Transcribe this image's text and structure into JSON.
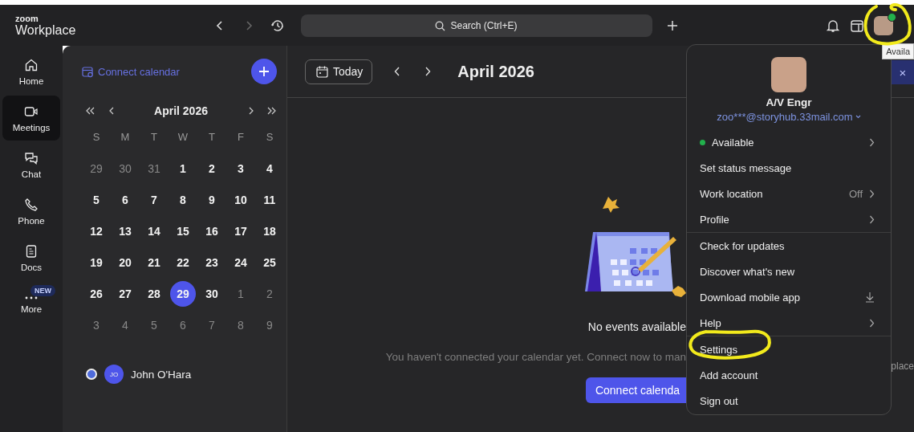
{
  "titlebar": {
    "logo_small": "zoom",
    "logo_name": "Workplace",
    "back_disabled": false,
    "forward_disabled": true,
    "search": {
      "placeholder": "Search (Ctrl+E)"
    },
    "online": true,
    "tooltip": "Availa"
  },
  "rail": [
    {
      "label": "Home",
      "selected": false
    },
    {
      "label": "Meetings",
      "selected": true
    },
    {
      "label": "Chat",
      "selected": false
    },
    {
      "label": "Phone",
      "selected": false
    },
    {
      "label": "Docs",
      "selected": false
    },
    {
      "label": "More",
      "selected": false,
      "badge": "NEW"
    }
  ],
  "calendar_panel": {
    "connect_link": "Connect calendar",
    "month": "April 2026",
    "weekdays": [
      "S",
      "M",
      "T",
      "W",
      "T",
      "F",
      "S"
    ],
    "days": [
      {
        "d": "29",
        "muted": true,
        "selected": false
      },
      {
        "d": "30",
        "muted": true,
        "selected": false
      },
      {
        "d": "31",
        "muted": true,
        "selected": false
      },
      {
        "d": "1",
        "muted": false,
        "selected": false
      },
      {
        "d": "2",
        "muted": false,
        "selected": false
      },
      {
        "d": "3",
        "muted": false,
        "selected": false
      },
      {
        "d": "4",
        "muted": false,
        "selected": false
      },
      {
        "d": "5",
        "muted": false,
        "selected": false
      },
      {
        "d": "6",
        "muted": false,
        "selected": false
      },
      {
        "d": "7",
        "muted": false,
        "selected": false
      },
      {
        "d": "8",
        "muted": false,
        "selected": false
      },
      {
        "d": "9",
        "muted": false,
        "selected": false
      },
      {
        "d": "10",
        "muted": false,
        "selected": false
      },
      {
        "d": "11",
        "muted": false,
        "selected": false
      },
      {
        "d": "12",
        "muted": false,
        "selected": false
      },
      {
        "d": "13",
        "muted": false,
        "selected": false
      },
      {
        "d": "14",
        "muted": false,
        "selected": false
      },
      {
        "d": "15",
        "muted": false,
        "selected": false
      },
      {
        "d": "16",
        "muted": false,
        "selected": false
      },
      {
        "d": "17",
        "muted": false,
        "selected": false
      },
      {
        "d": "18",
        "muted": false,
        "selected": false
      },
      {
        "d": "19",
        "muted": false,
        "selected": false
      },
      {
        "d": "20",
        "muted": false,
        "selected": false
      },
      {
        "d": "21",
        "muted": false,
        "selected": false
      },
      {
        "d": "22",
        "muted": false,
        "selected": false
      },
      {
        "d": "23",
        "muted": false,
        "selected": false
      },
      {
        "d": "24",
        "muted": false,
        "selected": false
      },
      {
        "d": "25",
        "muted": false,
        "selected": false
      },
      {
        "d": "26",
        "muted": false,
        "selected": false
      },
      {
        "d": "27",
        "muted": false,
        "selected": false
      },
      {
        "d": "28",
        "muted": false,
        "selected": false
      },
      {
        "d": "29",
        "muted": false,
        "selected": true
      },
      {
        "d": "30",
        "muted": false,
        "selected": false
      },
      {
        "d": "1",
        "muted": true,
        "selected": false
      },
      {
        "d": "2",
        "muted": true,
        "selected": false
      },
      {
        "d": "3",
        "muted": true,
        "selected": false
      },
      {
        "d": "4",
        "muted": true,
        "selected": false
      },
      {
        "d": "5",
        "muted": true,
        "selected": false
      },
      {
        "d": "6",
        "muted": true,
        "selected": false
      },
      {
        "d": "7",
        "muted": true,
        "selected": false
      },
      {
        "d": "8",
        "muted": true,
        "selected": false
      },
      {
        "d": "9",
        "muted": true,
        "selected": false
      }
    ],
    "people": [
      {
        "initials": "JO",
        "name": "John O'Hara",
        "selected": true
      }
    ]
  },
  "main": {
    "today_button": "Today",
    "month": "April 2026",
    "banner_close": "×",
    "empty_title": "No events available",
    "empty_message": "You haven't connected your calendar yet. Connect now to man",
    "empty_message_tail": "place",
    "connect_button": "Connect calenda"
  },
  "menu": {
    "name": "A/V Engr",
    "email": "zoo***@storyhub.33mail.com",
    "sections": [
      [
        {
          "kind": "status",
          "label": "Available",
          "color": "#22b14c"
        },
        {
          "kind": "plain",
          "label": "Set status message"
        },
        {
          "kind": "value",
          "label": "Work location",
          "value": "Off"
        },
        {
          "kind": "submenu",
          "label": "Profile"
        }
      ],
      [
        {
          "kind": "plain",
          "label": "Check for updates"
        },
        {
          "kind": "plain",
          "label": "Discover what's new"
        },
        {
          "kind": "download",
          "label": "Download mobile app"
        },
        {
          "kind": "submenu",
          "label": "Help"
        }
      ],
      [
        {
          "kind": "plain",
          "label": "Settings"
        },
        {
          "kind": "plain",
          "label": "Add account"
        },
        {
          "kind": "plain",
          "label": "Sign out"
        }
      ]
    ]
  }
}
